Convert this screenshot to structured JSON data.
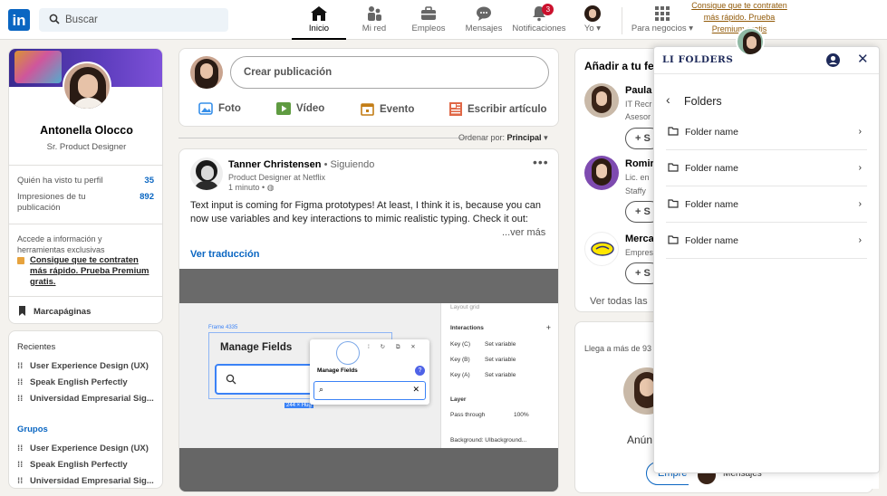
{
  "nav": {
    "logo": "in",
    "search_placeholder": "Buscar",
    "items": [
      {
        "label": "Inicio",
        "icon": "home-icon"
      },
      {
        "label": "Mi red",
        "icon": "network-icon"
      },
      {
        "label": "Empleos",
        "icon": "briefcase-icon"
      },
      {
        "label": "Mensajes",
        "icon": "messaging-icon"
      },
      {
        "label": "Notificaciones",
        "icon": "bell-icon",
        "badge": "3"
      },
      {
        "label": "Yo",
        "icon": "avatar"
      },
      {
        "label": "Para negocios",
        "icon": "grid-icon"
      }
    ],
    "premium_link": "Consigue que te contraten más rápido. Prueba Premium gratis"
  },
  "profile": {
    "name": "Antonella Olocco",
    "title": "Sr. Product Designer",
    "stats": [
      {
        "label": "Quién ha visto tu perfil",
        "value": "35"
      },
      {
        "label": "Impresiones de tu publicación",
        "value": "892"
      }
    ],
    "premium_text": "Accede a información y herramientas exclusivas",
    "premium_link": "Consigue que te contraten más rápido. Prueba Premium gratis.",
    "bookmarks": "Marcapáginas"
  },
  "recent": {
    "title": "Recientes",
    "items": [
      "User Experience Design (UX)",
      "Speak English Perfectly",
      "Universidad Empresarial Sig..."
    ],
    "groups_title": "Grupos",
    "groups": [
      "User Experience Design (UX)",
      "Speak English Perfectly",
      "Universidad Empresarial Sig..."
    ]
  },
  "composer": {
    "placeholder": "Crear publicación",
    "actions": [
      "Foto",
      "Vídeo",
      "Evento",
      "Escribir artículo"
    ],
    "sort_label": "Ordenar por:",
    "sort_value": "Principal"
  },
  "post": {
    "author": "Tanner Christensen",
    "follow_state": "• Siguiendo",
    "headline": "Product Designer at Netflix",
    "time": "1 minuto •",
    "text": "Text input is coming for Figma prototypes! At least, I think it is, because you can now use variables and key interactions to mimic realistic typing. Check it out:",
    "more": "...ver más",
    "translate": "Ver traducción",
    "figma": {
      "frame_label": "Frame 4335",
      "title": "Manage Fields",
      "size_label": "244 × Hug",
      "popup_title": "Manage Fields",
      "interactions_label": "Interactions",
      "layout_grid": "Layout grid",
      "rows": [
        {
          "key": "Key (C)",
          "action": "Set variable"
        },
        {
          "key": "Key (B)",
          "action": "Set variable"
        },
        {
          "key": "Key (A)",
          "action": "Set variable"
        }
      ],
      "layer_label": "Layer",
      "pass_through": "Pass through",
      "opacity": "100%",
      "background": "Background: UIbackground..."
    }
  },
  "suggestions": {
    "title": "Añadir a tu fe",
    "people": [
      {
        "name": "Paula",
        "line1": "IT Recr",
        "line2": "Asesor"
      },
      {
        "name": "Romir",
        "line1": "Lic. en",
        "line2": "Staffy"
      },
      {
        "name": "Merca",
        "line1": "Empres",
        "line2": ""
      }
    ],
    "follow_label": "+ S",
    "see_all": "Ver todas las"
  },
  "promo": {
    "text": "Llega a más de 93",
    "name_partial": "Anún",
    "button": "Empre",
    "messages": "Mensajes"
  },
  "panel": {
    "brand": "LI FOLDERS",
    "back_title": "Folders",
    "folders": [
      "Folder name",
      "Folder name",
      "Folder name",
      "Folder name"
    ]
  },
  "colors": {
    "brand_blue": "#0a66c2",
    "premium_gold": "#915907",
    "badge_red": "#cb112d"
  }
}
